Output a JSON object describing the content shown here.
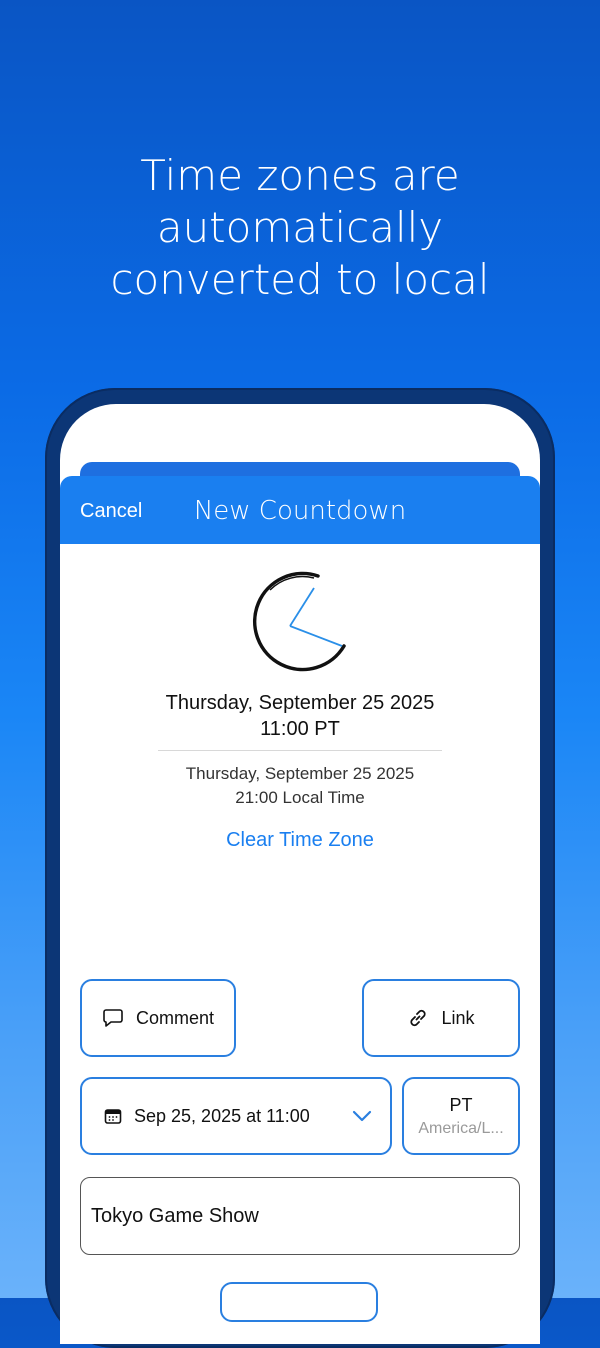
{
  "headline": {
    "line1": "Time zones are automatically",
    "line2": "converted to local"
  },
  "navbar": {
    "cancel_label": "Cancel",
    "title": "New Countdown"
  },
  "event_time": {
    "date": "Thursday, September 25 2025",
    "time": "11:00 PT"
  },
  "local_time": {
    "date": "Thursday, September 25 2025",
    "time": "21:00 Local Time"
  },
  "clear_timezone_label": "Clear Time Zone",
  "buttons": {
    "comment_label": "Comment",
    "link_label": "Link"
  },
  "date_picker": {
    "value": "Sep 25, 2025 at 11:00",
    "icon": "calendar-icon"
  },
  "timezone": {
    "abbr": "PT",
    "region": "America/L..."
  },
  "title_field": {
    "value": "Tokyo Game Show"
  },
  "colors": {
    "accent": "#1a7ff0",
    "button_border": "#2a7fe0",
    "phone_frame": "#0c3676"
  }
}
